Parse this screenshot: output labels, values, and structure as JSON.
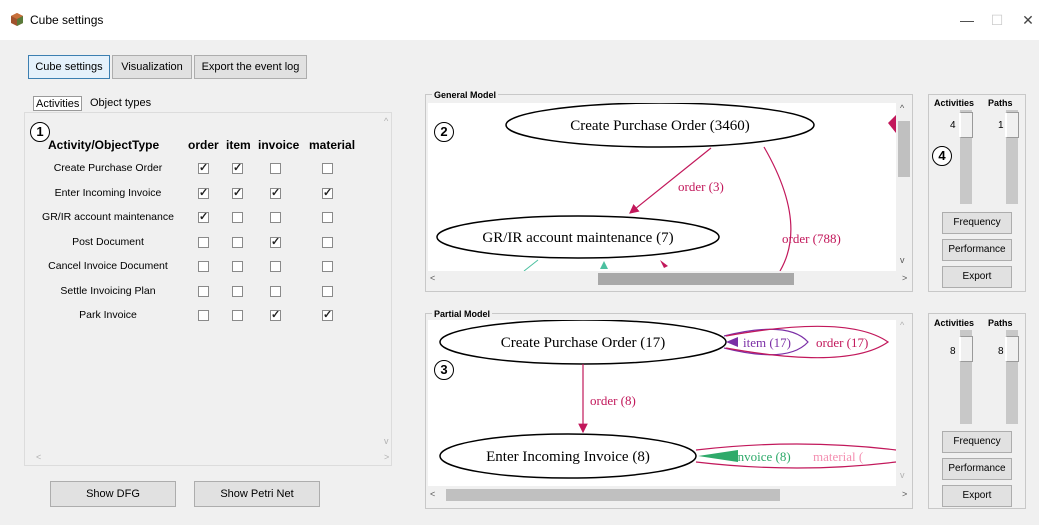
{
  "window": {
    "title": "Cube settings",
    "min_glyph": "—",
    "max_glyph": "☐",
    "close_glyph": "✕"
  },
  "toolbar": {
    "cube_settings": "Cube settings",
    "visualization": "Visualization",
    "export": "Export the event log"
  },
  "tabs": {
    "activities": "Activities",
    "object_types": "Object types"
  },
  "table": {
    "headers": [
      "Activity/ObjectType",
      "order",
      "item",
      "invoice",
      "material"
    ],
    "rows": [
      {
        "label": "Create Purchase Order",
        "checks": [
          true,
          true,
          false,
          false
        ]
      },
      {
        "label": "Enter Incoming Invoice",
        "checks": [
          true,
          true,
          true,
          true
        ]
      },
      {
        "label": "GR/IR account maintenance",
        "checks": [
          true,
          false,
          false,
          false
        ]
      },
      {
        "label": "Post Document",
        "checks": [
          false,
          false,
          true,
          false
        ]
      },
      {
        "label": "Cancel Invoice Document",
        "checks": [
          false,
          false,
          false,
          false
        ]
      },
      {
        "label": "Settle Invoicing Plan",
        "checks": [
          false,
          false,
          false,
          false
        ]
      },
      {
        "label": "Park Invoice",
        "checks": [
          false,
          false,
          true,
          true
        ]
      }
    ]
  },
  "buttons": {
    "show_dfg": "Show DFG",
    "show_petri": "Show Petri Net"
  },
  "badges": {
    "b1": "1",
    "b2": "2",
    "b3": "3",
    "b4": "4"
  },
  "general_model": {
    "label": "General Model",
    "node1": "Create Purchase Order (3460)",
    "node2": "GR/IR account maintenance (7)",
    "edge1": "order (3)",
    "edge2": "order (788)"
  },
  "partial_model": {
    "label": "Partial Model",
    "node1": "Create Purchase Order (17)",
    "node2": "Enter Incoming Invoice (8)",
    "edge1": "order (8)",
    "loop1a": "item (17)",
    "loop1b": "order (17)",
    "loop2a": "invoice (8)",
    "loop2b": "material ("
  },
  "controls_top": {
    "activities": "Activities",
    "paths": "Paths",
    "act_val": "4",
    "path_val": "1",
    "frequency": "Frequency",
    "performance": "Performance",
    "export": "Export"
  },
  "controls_bottom": {
    "activities": "Activities",
    "paths": "Paths",
    "act_val": "8",
    "path_val": "8",
    "frequency": "Frequency",
    "performance": "Performance",
    "export": "Export"
  },
  "colors": {
    "edge_red": "#c2185b",
    "edge_purple": "#7b2fa6",
    "edge_green": "#2eaa6a",
    "cube_icon": "#8b4a2b"
  }
}
